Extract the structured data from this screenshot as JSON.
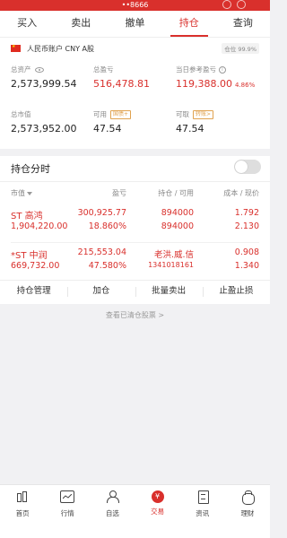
{
  "status_bar": {
    "account_mask": "••8666"
  },
  "tabs": [
    {
      "label": "买入"
    },
    {
      "label": "卖出"
    },
    {
      "label": "撤单"
    },
    {
      "label": "持仓",
      "active": true
    },
    {
      "label": "查询"
    }
  ],
  "account": {
    "title": "人民币账户 CNY A股",
    "position_ratio": "仓位 99.9%",
    "total_assets_label": "总资产",
    "total_assets": "2,573,999.54",
    "total_pnl_label": "总盈亏",
    "total_pnl": "516,478.81",
    "today_pnl_label": "当日参考盈亏",
    "today_pnl": "119,388.00",
    "today_pnl_pct": "4.86%",
    "market_value_label": "总市值",
    "market_value": "2,573,952.00",
    "available_label": "可用",
    "available_tag": "国债+",
    "available": "47.54",
    "withdrawable_label": "可取",
    "withdrawable_tag": "转账>",
    "withdrawable": "47.54"
  },
  "holdings": {
    "title": "持仓分时",
    "toggle_on": false,
    "columns": {
      "market_value": "市值",
      "pnl": "盈亏",
      "position": "持仓 / 可用",
      "cost": "成本 / 现价"
    },
    "rows": [
      {
        "name": "ST 高鸿",
        "market_value": "1,904,220.00",
        "pnl": "300,925.77",
        "pnl_pct": "18.860%",
        "position": "894000",
        "available": "894000",
        "cost": "1.792",
        "price": "2.130"
      },
      {
        "name": "*ST 中润",
        "market_value": "669,732.00",
        "pnl": "215,553.04",
        "pnl_pct": "47.580%",
        "position": "老洪.威.信",
        "available": "1341018161",
        "cost": "0.908",
        "price": "1.340"
      }
    ],
    "actions": [
      "持仓管理",
      "加仓",
      "批量卖出",
      "止盈止损"
    ]
  },
  "cleared_link": "查看已清仓股票 >",
  "bottom_nav": [
    {
      "label": "首页",
      "icon": "candlestick-icon"
    },
    {
      "label": "行情",
      "icon": "chart-icon"
    },
    {
      "label": "自选",
      "icon": "person-icon"
    },
    {
      "label": "交易",
      "icon": "trade-icon",
      "active": true,
      "glyph": "¥"
    },
    {
      "label": "资讯",
      "icon": "doc-icon"
    },
    {
      "label": "理财",
      "icon": "money-bag-icon"
    }
  ],
  "colors": {
    "accent": "#d9302c",
    "tag": "#e0a24f"
  }
}
